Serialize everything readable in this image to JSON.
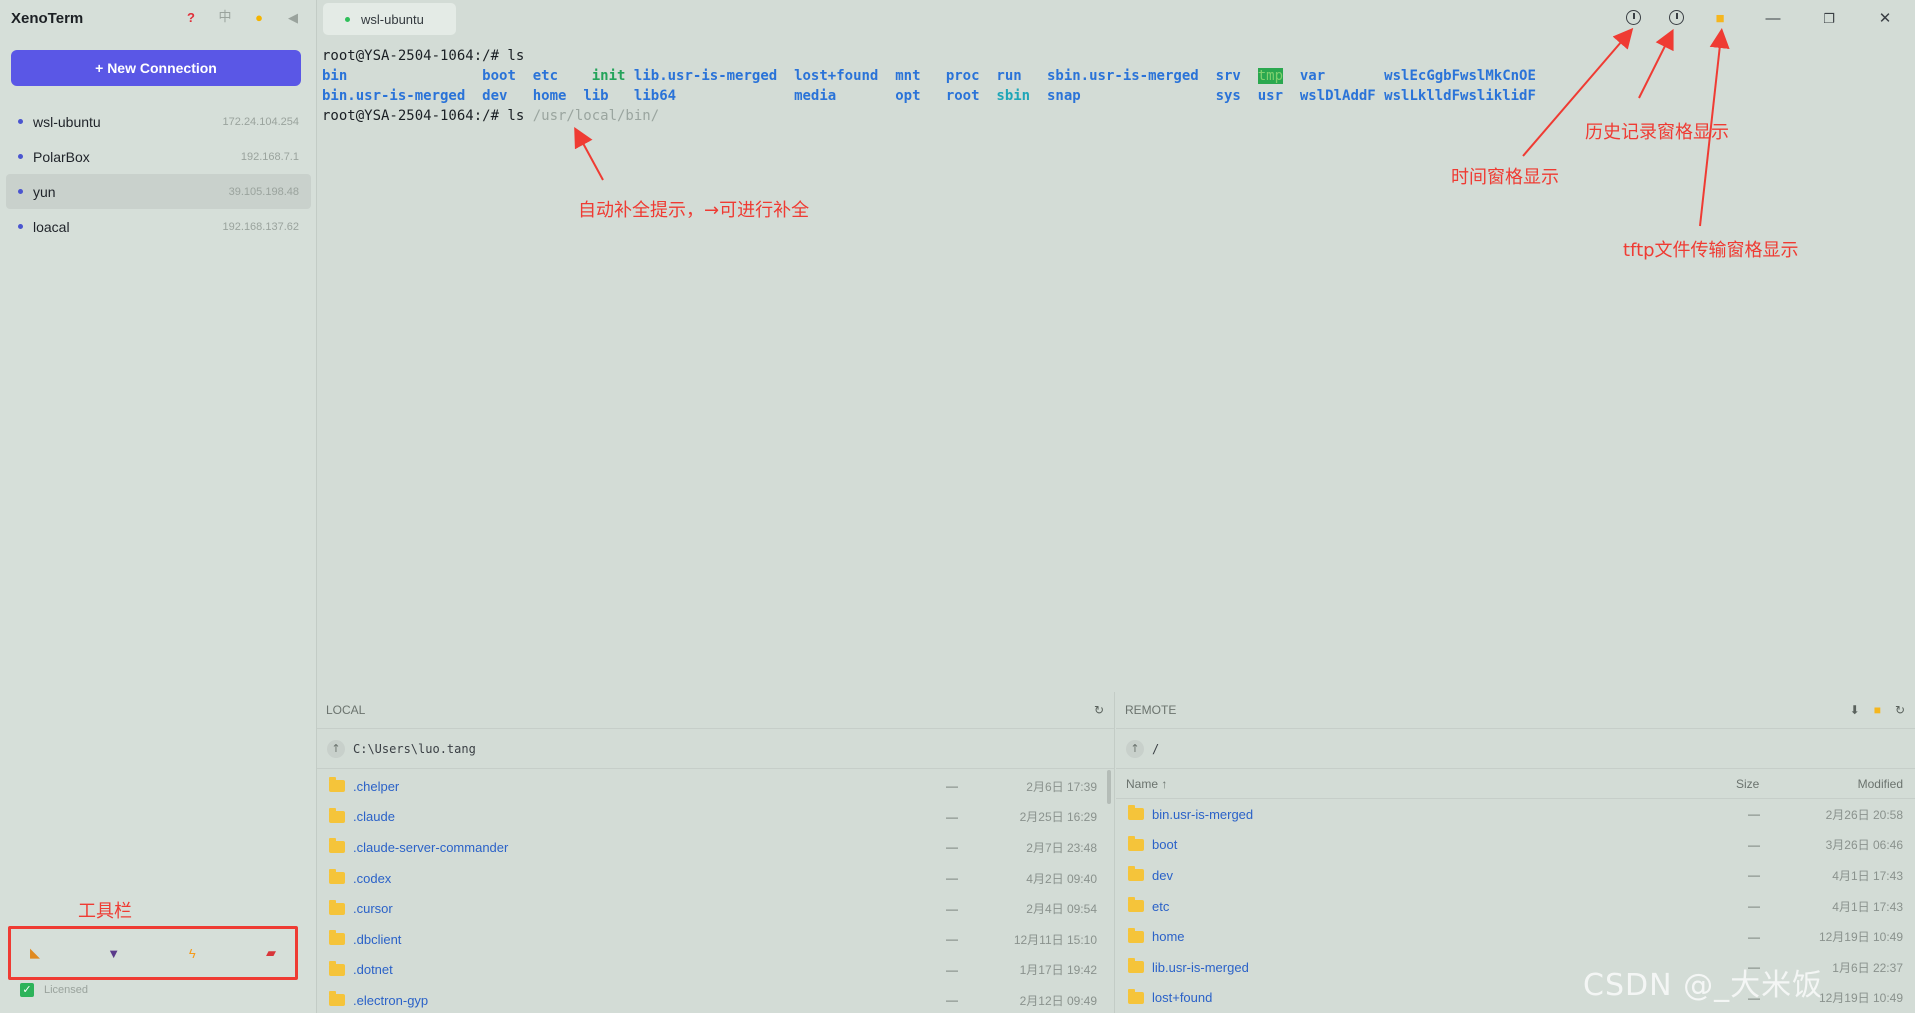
{
  "app": {
    "title": "XenoTerm"
  },
  "sidebar": {
    "header_icons": {
      "help": "?",
      "lang": "中",
      "theme": "sun-icon",
      "collapse": "◀"
    },
    "new_connection_label": "+ New Connection",
    "connections": [
      {
        "name": "wsl-ubuntu",
        "ip": "172.24.104.254"
      },
      {
        "name": "PolarBox",
        "ip": "192.168.7.1"
      },
      {
        "name": "yun",
        "ip": "39.105.198.48"
      },
      {
        "name": "loacal",
        "ip": "192.168.137.62"
      }
    ],
    "toolbar_label": "工具栏",
    "licensed_label": "Licensed"
  },
  "tabs": [
    {
      "label": "wsl-ubuntu"
    }
  ],
  "terminal": {
    "prompt1": "root@YSA-2504-1064:/# ls",
    "row1": [
      "bin",
      "boot",
      "etc",
      "init",
      "lib.usr-is-merged",
      "lost+found",
      "mnt",
      "proc",
      "run",
      "sbin.usr-is-merged",
      "srv",
      "tmp",
      "var",
      "wslEcGgbF",
      "wslMkCnOE"
    ],
    "row2": [
      "bin.usr-is-merged",
      "dev",
      "home",
      "lib",
      "lib64",
      "media",
      "opt",
      "root",
      "sbin",
      "snap",
      "sys",
      "usr",
      "wslDlAddF",
      "wslLklldF",
      "wsliklidF"
    ],
    "prompt2": "root@YSA-2504-1064:/# ls ",
    "suggestion": "/usr/local/bin/"
  },
  "annotations": {
    "autocomplete": "自动补全提示，→可进行补全",
    "time_pane": "时间窗格显示",
    "history_pane": "历史记录窗格显示",
    "tftp_pane": "tftp文件传输窗格显示"
  },
  "local": {
    "title": "LOCAL",
    "path": "C:\\Users\\luo.tang",
    "rows": [
      {
        "name": ".chelper",
        "size": "—",
        "date": "2月6日 17:39"
      },
      {
        "name": ".claude",
        "size": "—",
        "date": "2月25日 16:29"
      },
      {
        "name": ".claude-server-commander",
        "size": "—",
        "date": "2月7日 23:48"
      },
      {
        "name": ".codex",
        "size": "—",
        "date": "4月2日 09:40"
      },
      {
        "name": ".cursor",
        "size": "—",
        "date": "2月4日 09:54"
      },
      {
        "name": ".dbclient",
        "size": "—",
        "date": "12月11日 15:10"
      },
      {
        "name": ".dotnet",
        "size": "—",
        "date": "1月17日 19:42"
      },
      {
        "name": ".electron-gyp",
        "size": "—",
        "date": "2月12日 09:49"
      }
    ]
  },
  "remote": {
    "title": "REMOTE",
    "path": "/",
    "col_name": "Name ↑",
    "col_size": "Size",
    "col_modified": "Modified",
    "rows": [
      {
        "name": "bin.usr-is-merged",
        "size": "—",
        "date": "2月26日 20:58"
      },
      {
        "name": "boot",
        "size": "—",
        "date": "3月26日 06:46"
      },
      {
        "name": "dev",
        "size": "—",
        "date": "4月1日 17:43"
      },
      {
        "name": "etc",
        "size": "—",
        "date": "4月1日 17:43"
      },
      {
        "name": "home",
        "size": "—",
        "date": "12月19日 10:49"
      },
      {
        "name": "lib.usr-is-merged",
        "size": "—",
        "date": "1月6日 22:37"
      },
      {
        "name": "lost+found",
        "size": "—",
        "date": "12月19日 10:49"
      }
    ]
  },
  "watermark": "CSDN @_大米饭",
  "colors": {
    "accent": "#5a57e6",
    "annotation": "#ef3b33",
    "dir_blue": "#2a73d8",
    "exec_green": "#23a35a"
  }
}
